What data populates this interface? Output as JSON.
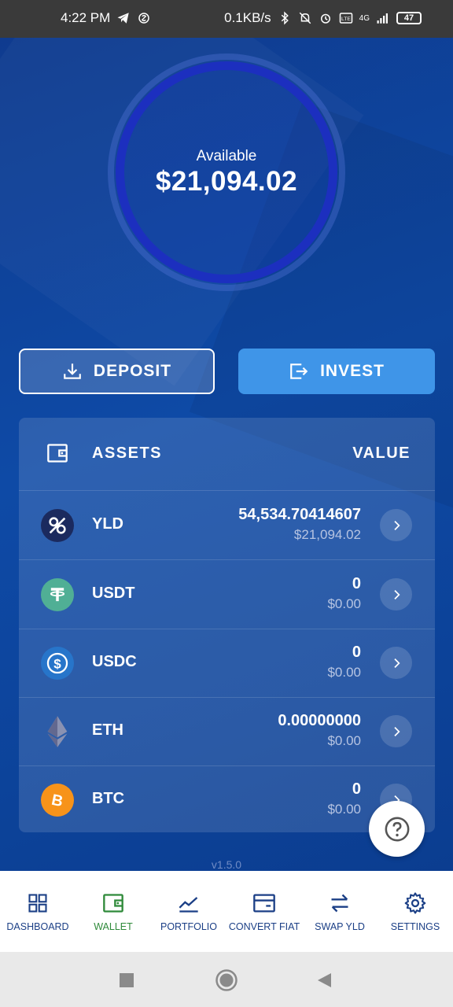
{
  "status_bar": {
    "time": "4:22 PM",
    "speed": "0.1KB/s",
    "network": "4G",
    "battery": "47"
  },
  "balance": {
    "label": "Available",
    "amount": "$21,094.02"
  },
  "actions": {
    "deposit_label": "DEPOSIT",
    "invest_label": "INVEST"
  },
  "assets": {
    "header_assets": "ASSETS",
    "header_value": "VALUE",
    "rows": [
      {
        "symbol": "YLD",
        "amount": "54,534.70414607",
        "usd": "$21,094.02",
        "color": "#1b2a5e"
      },
      {
        "symbol": "USDT",
        "amount": "0",
        "usd": "$0.00",
        "color": "#50af95"
      },
      {
        "symbol": "USDC",
        "amount": "0",
        "usd": "$0.00",
        "color": "#2775ca"
      },
      {
        "symbol": "ETH",
        "amount": "0.00000000",
        "usd": "$0.00",
        "color": "#8a92b2"
      },
      {
        "symbol": "BTC",
        "amount": "0",
        "usd": "$0.00",
        "color": "#f7931a"
      }
    ]
  },
  "version": "v1.5.0",
  "nav": {
    "items": [
      {
        "label": "DASHBOARD",
        "icon": "grid-icon"
      },
      {
        "label": "WALLET",
        "icon": "wallet-icon",
        "active": true
      },
      {
        "label": "PORTFOLIO",
        "icon": "chart-line-icon"
      },
      {
        "label": "CONVERT FIAT",
        "icon": "card-icon"
      },
      {
        "label": "SWAP YLD",
        "icon": "swap-icon"
      },
      {
        "label": "SETTINGS",
        "icon": "gear-icon"
      }
    ],
    "active_color": "#2f8a3a",
    "color": "#1b3f86"
  }
}
